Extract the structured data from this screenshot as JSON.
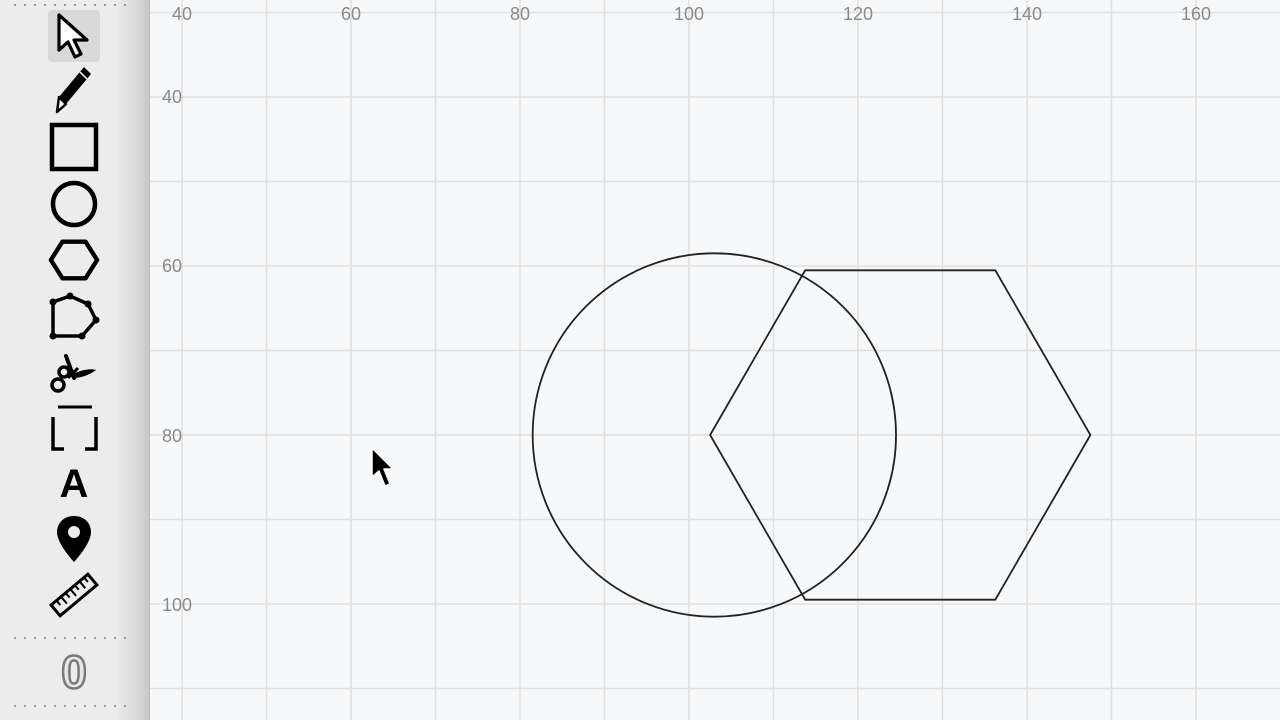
{
  "toolbar": {
    "tools": [
      {
        "name": "select-tool",
        "icon": "arrow-cursor-icon",
        "selected": true
      },
      {
        "name": "pencil-tool",
        "icon": "pencil-icon"
      },
      {
        "name": "rectangle-tool",
        "icon": "square-icon"
      },
      {
        "name": "circle-tool",
        "icon": "circle-icon"
      },
      {
        "name": "hexagon-tool",
        "icon": "hexagon-icon"
      },
      {
        "name": "polygon-tool",
        "icon": "polygon-icon"
      },
      {
        "name": "scissors-tool",
        "icon": "scissors-icon"
      },
      {
        "name": "bracket-tool",
        "icon": "bracket-frame-icon"
      },
      {
        "name": "text-tool",
        "icon": "text-icon",
        "label": "A"
      },
      {
        "name": "marker-tool",
        "icon": "map-pin-icon"
      },
      {
        "name": "ruler-tool",
        "icon": "ruler-icon"
      },
      {
        "name": "zero-tool",
        "icon": "zero-icon",
        "label": "0"
      }
    ]
  },
  "canvas": {
    "background": "#f7f8fa",
    "grid_color": "#e0e0e0",
    "x_ticks": [
      "40",
      "60",
      "80",
      "100",
      "120",
      "140",
      "160"
    ],
    "y_ticks": [
      "40",
      "60",
      "80",
      "100"
    ],
    "shapes": [
      {
        "type": "circle",
        "center": [
          103,
          80
        ],
        "radius": 21.5
      },
      {
        "type": "hexagon",
        "center": [
          125,
          80
        ],
        "radius": 22.5
      }
    ]
  }
}
